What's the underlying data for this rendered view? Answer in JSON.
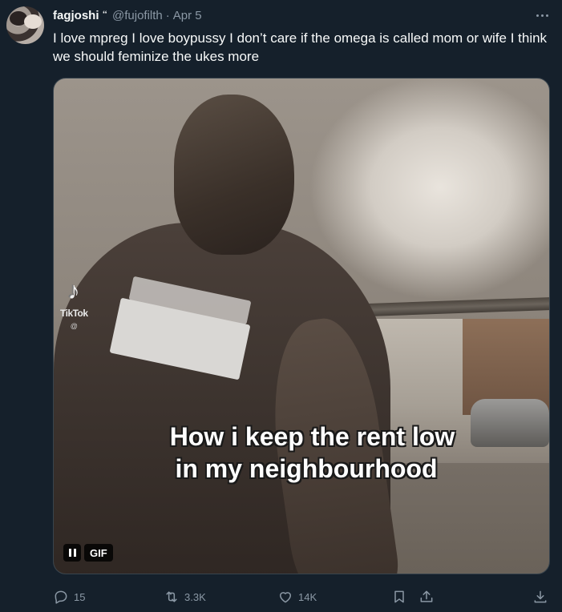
{
  "tweet": {
    "author_name": "fagjoshi",
    "author_badge": "🙶",
    "handle": "@fujofilth",
    "separator": "·",
    "date": "Apr 5",
    "text": "I love mpreg I love boypussy I don’t care if the omega is called mom or wife I think we should feminize the ukes more"
  },
  "media": {
    "watermark_logo": "♪",
    "watermark_name": "TikTok",
    "watermark_user": "@",
    "caption_line_1": "How i keep the rent low",
    "caption_line_2": "in my neighbourhood",
    "gif_label": "GIF"
  },
  "actions": {
    "replies": "15",
    "retweets": "3.3K",
    "likes": "14K"
  },
  "icons": {
    "more": "more-icon",
    "reply": "reply-icon",
    "retweet": "retweet-icon",
    "like": "heart-icon",
    "bookmark": "bookmark-icon",
    "share": "share-icon",
    "download": "download-icon",
    "pause": "pause-icon"
  },
  "colors": {
    "background": "#15202b",
    "text_primary": "#f7f9f9",
    "text_secondary": "#8b98a5"
  }
}
